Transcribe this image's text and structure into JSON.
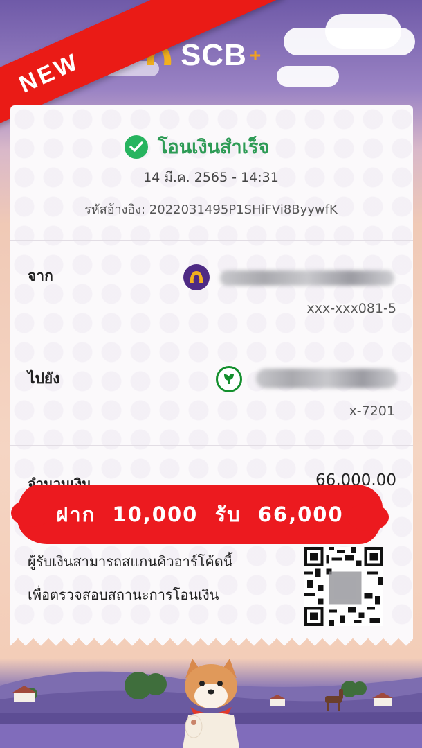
{
  "ribbon": {
    "label": "NEW"
  },
  "header": {
    "brand": "SCB",
    "plus": "+"
  },
  "status": {
    "text": "โอนเงินสำเร็จ"
  },
  "datetime": "14 มี.ค. 2565 - 14:31",
  "reference": "รหัสอ้างอิง: 2022031495P1SHiFVi8ByywfK",
  "from": {
    "label": "จาก",
    "account": "xxx-xxx081-5"
  },
  "to": {
    "label": "ไปยัง",
    "account": "x-7201"
  },
  "amount": {
    "label": "จำนวนเงิน",
    "value": "66,000.00"
  },
  "promo": {
    "deposit_word": "ฝาก",
    "deposit_amount": "10,000",
    "receive_word": "รับ",
    "receive_amount": "66,000"
  },
  "qr": {
    "line1": "ผู้รับเงินสามารถสแกนคิวอาร์โค้ดนี้",
    "line2": "เพื่อตรวจสอบสถานะการโอนเงิน"
  },
  "colors": {
    "scb_purple": "#4e2a84",
    "success_green": "#27b45f",
    "promo_red": "#ec1a1f",
    "kbank_green": "#138f2d"
  }
}
